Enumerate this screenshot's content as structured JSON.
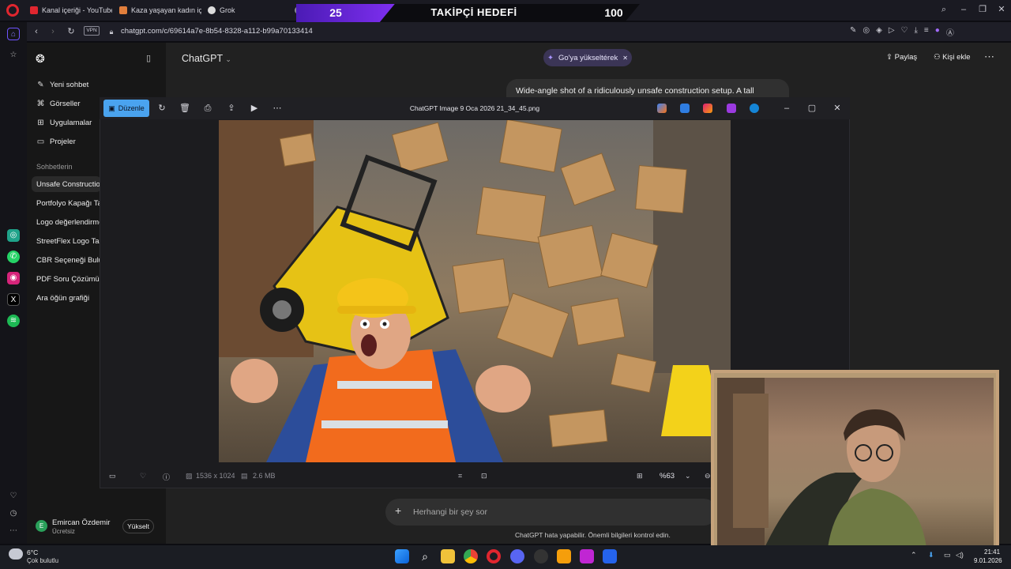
{
  "stream_overlay": {
    "current": "25",
    "title": "TAKİPÇİ HEDEFİ",
    "goal": "100"
  },
  "browser": {
    "tabs": [
      {
        "label": "Kanal içeriği - YouTube St",
        "color": "#e0262f"
      },
      {
        "label": "Kaza yaşayan kadın için se",
        "color": "#e27f3c"
      },
      {
        "label": "Grok",
        "color": "#dcdcdc"
      },
      {
        "label": "U",
        "color": "#8a8a96"
      }
    ],
    "url": "chatgpt.com/c/69614a7e-8b54-8328-a112-b99a70133414",
    "vpn": "VPN"
  },
  "sidebar": {
    "menu": [
      {
        "label": "Yeni sohbet",
        "icon": "edit-icon"
      },
      {
        "label": "Görseller",
        "icon": "images-icon"
      },
      {
        "label": "Uygulamalar",
        "icon": "apps-icon"
      },
      {
        "label": "Projeler",
        "icon": "folder-icon"
      }
    ],
    "section_label": "Sohbetlerin",
    "conversations": [
      "Unsafe Construction",
      "Portfolyo Kapağı Ta",
      "Logo değerlendirme",
      "StreetFlex Logo Tas",
      "CBR Seçeneği Bulun",
      "PDF Soru Çözümü Y",
      "Ara öğün grafiği"
    ],
    "user": {
      "name": "Emircan Özdemir",
      "plan": "Ücretsiz",
      "initial": "E",
      "upgrade": "Yükselt"
    }
  },
  "header": {
    "model": "ChatGPT",
    "upgrade_pill": "Go'ya yükseltérek",
    "share": "Paylaş",
    "add_people": "Kişi ekle"
  },
  "chat": {
    "prompt": "Wide-angle shot of a ridiculously unsafe construction setup. A tall"
  },
  "viewer": {
    "edit_label": "Düzenle",
    "title": "ChatGPT Image 9 Oca 2026 21_34_45.png",
    "dimensions": "1536 x 1024",
    "size": "2.6 MB",
    "zoom": "%63"
  },
  "composer": {
    "placeholder": "Herhangi bir şey sor",
    "disclaimer": "ChatGPT hata yapabilir. Önemli bilgileri kontrol edin."
  },
  "taskbar": {
    "temp": "6°C",
    "weather": "Çok bulutlu",
    "time": "21:41",
    "date": "9.01.2026"
  },
  "colors": {
    "accent": "#4aa3ef",
    "overlay_purple": "#7e2ff0"
  }
}
